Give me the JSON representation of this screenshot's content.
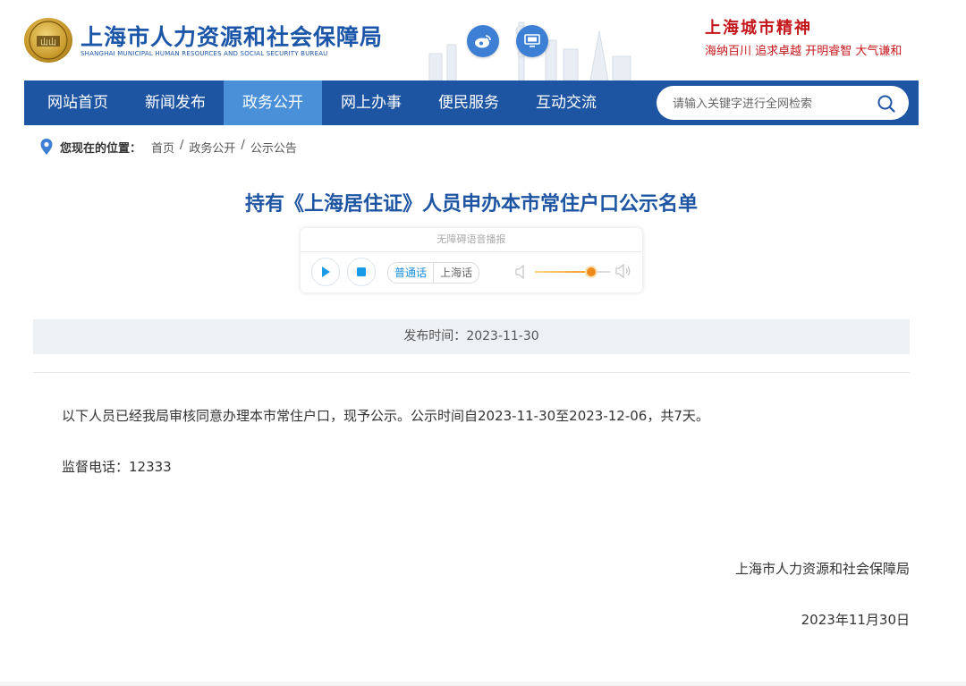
{
  "header": {
    "logo_cn": "上海市人力资源和社会保障局",
    "logo_en": "SHANGHAI MUNICIPAL HUMAN RESOURCES AND SOCIAL SECURITY BUREAU",
    "emblem_text": "山山",
    "weibo_icon": "weibo-icon",
    "desktop_icon": "desktop-icon",
    "spirit_title": "上海城市精神",
    "spirit_sub": "海纳百川  追求卓越  开明睿智  大气谦和"
  },
  "nav": {
    "items": [
      {
        "label": "网站首页",
        "active": false
      },
      {
        "label": "新闻发布",
        "active": false
      },
      {
        "label": "政务公开",
        "active": true
      },
      {
        "label": "网上办事",
        "active": false
      },
      {
        "label": "便民服务",
        "active": false
      },
      {
        "label": "互动交流",
        "active": false
      }
    ],
    "search_placeholder": "请输入关键字进行全网检索"
  },
  "breadcrumb": {
    "label": "您现在的位置：",
    "items": [
      "首页",
      "政务公开",
      "公示公告"
    ],
    "separator": "/"
  },
  "article": {
    "title": "持有《上海居住证》人员申办本市常住户口公示名单",
    "publish_label": "发布时间：",
    "publish_date": "2023-11-30",
    "paragraph1": "以下人员已经我局审核同意办理本市常住户口，现予公示。公示时间自2023-11-30至2023-12-06，共7天。",
    "paragraph2": "监督电话：12333",
    "signature": "上海市人力资源和社会保障局",
    "sign_date": "2023年11月30日"
  },
  "player": {
    "title": "无障碍语音播报",
    "lang_options": [
      "普通话",
      "上海话"
    ],
    "selected_lang": "普通话",
    "volume": 0.75
  },
  "colors": {
    "nav_bg": "#1e55a3",
    "nav_active": "#4a90d9",
    "title_blue": "#1e55a3",
    "spirit_red": "#c4171c"
  }
}
